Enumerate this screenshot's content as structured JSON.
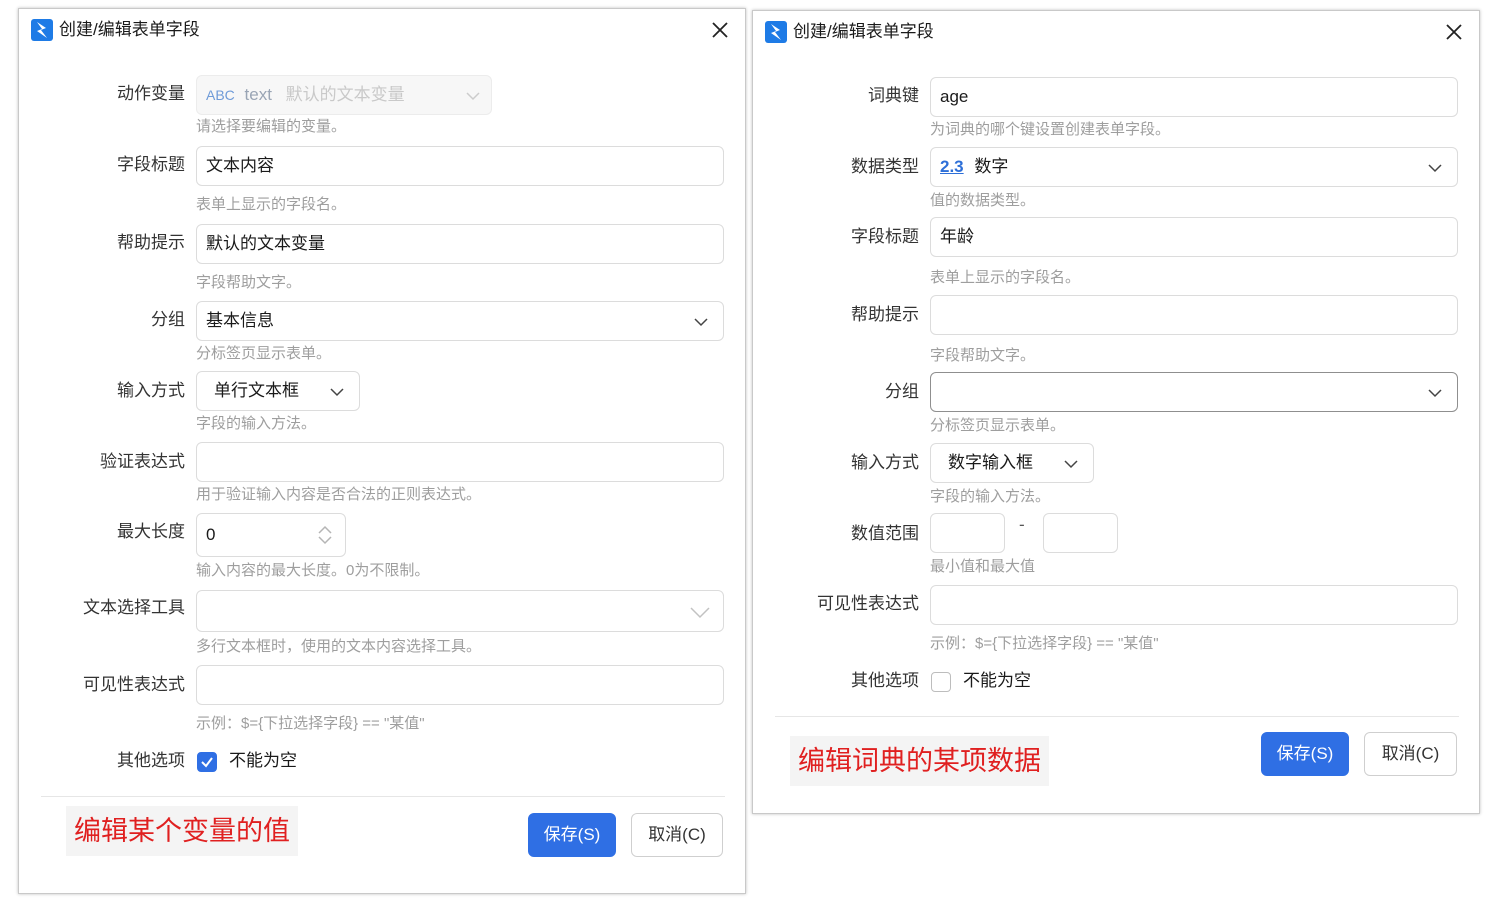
{
  "left_dialog": {
    "title": "创建/编辑表单字段",
    "fields": {
      "action_variable": {
        "label": "动作变量",
        "type_badge": "ABC",
        "value": "text",
        "hint": "默认的文本变量",
        "help": "请选择要编辑的变量。"
      },
      "field_title": {
        "label": "字段标题",
        "value": "文本内容",
        "help": "表单上显示的字段名。"
      },
      "help_tip": {
        "label": "帮助提示",
        "value": "默认的文本变量",
        "help": "字段帮助文字。"
      },
      "group": {
        "label": "分组",
        "value": "基本信息",
        "help": "分标签页显示表单。"
      },
      "input_method": {
        "label": "输入方式",
        "value": "单行文本框",
        "help": "字段的输入方法。"
      },
      "validation": {
        "label": "验证表达式",
        "value": "",
        "help": "用于验证输入内容是否合法的正则表达式。"
      },
      "max_length": {
        "label": "最大长度",
        "value": "0",
        "help": "输入内容的最大长度。0为不限制。"
      },
      "text_picker": {
        "label": "文本选择工具",
        "value": "",
        "help": "多行文本框时，使用的文本内容选择工具。"
      },
      "visibility": {
        "label": "可见性表达式",
        "value": "",
        "help": "示例：$={下拉选择字段} == \"某值\""
      },
      "other_options": {
        "label": "其他选项",
        "checkbox_label": "不能为空",
        "checked": true
      }
    },
    "note": "编辑某个变量的值",
    "save_label": "保存(S)",
    "cancel_label": "取消(C)"
  },
  "right_dialog": {
    "title": "创建/编辑表单字段",
    "fields": {
      "dict_key": {
        "label": "词典键",
        "value": "age",
        "help": "为词典的哪个键设置创建表单字段。"
      },
      "data_type": {
        "label": "数据类型",
        "type_badge": "2.3",
        "value": "数字",
        "help": "值的数据类型。"
      },
      "field_title": {
        "label": "字段标题",
        "value": "年龄",
        "help": "表单上显示的字段名。"
      },
      "help_tip": {
        "label": "帮助提示",
        "value": "",
        "help": "字段帮助文字。"
      },
      "group": {
        "label": "分组",
        "value": "",
        "help": "分标签页显示表单。"
      },
      "input_method": {
        "label": "输入方式",
        "value": "数字输入框",
        "help": "字段的输入方法。"
      },
      "value_range": {
        "label": "数值范围",
        "min": "",
        "separator": "-",
        "max": "",
        "help": "最小值和最大值"
      },
      "visibility": {
        "label": "可见性表达式",
        "value": "",
        "help": "示例：$={下拉选择字段} == \"某值\""
      },
      "other_options": {
        "label": "其他选项",
        "checkbox_label": "不能为空",
        "checked": false
      }
    },
    "note": "编辑词典的某项数据",
    "save_label": "保存(S)",
    "cancel_label": "取消(C)"
  },
  "colors": {
    "primary": "#2f6fe4",
    "note_text": "#e02020",
    "help_text": "#9e9e9e",
    "border": "#dcdcdc"
  },
  "icons": [
    "app-logo-icon",
    "close-icon",
    "chevron-down-icon",
    "spinner-icon",
    "check-icon"
  ]
}
